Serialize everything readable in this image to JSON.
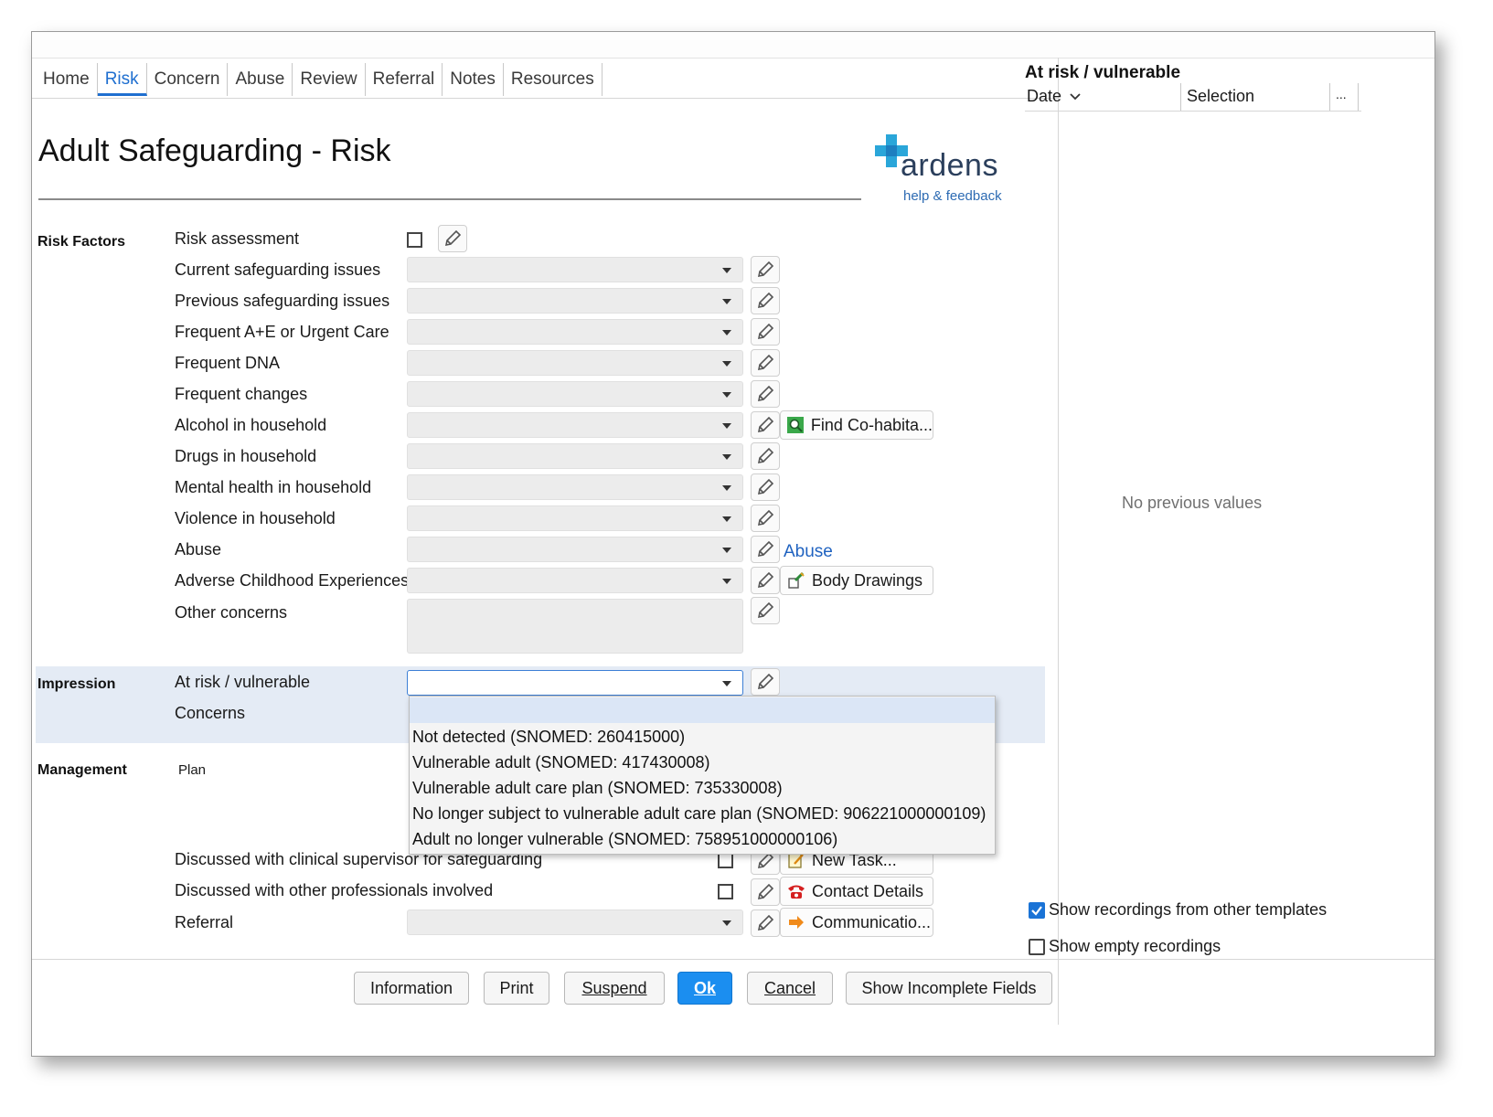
{
  "tabs": [
    "Home",
    "Risk",
    "Concern",
    "Abuse",
    "Review",
    "Referral",
    "Notes",
    "Resources"
  ],
  "active_tab": "Risk",
  "page_title": "Adult Safeguarding - Risk",
  "logo": {
    "name": "ardens",
    "link": "help & feedback"
  },
  "sections": {
    "risk_factors": "Risk Factors",
    "impression": "Impression",
    "management": "Management"
  },
  "risk": {
    "risk_assessment": "Risk assessment",
    "rows": [
      "Current safeguarding issues",
      "Previous safeguarding issues",
      "Frequent A+E or Urgent Care",
      "Frequent DNA",
      "Frequent changes",
      "Alcohol in household",
      "Drugs in household",
      "Mental health in household",
      "Violence in household",
      "Abuse",
      "Adverse Childhood Experiences"
    ],
    "other_concerns": "Other concerns",
    "find_cohabitants": "Find Co-habita...",
    "abuse_link": "Abuse",
    "body_drawings": "Body Drawings"
  },
  "impression": {
    "at_risk": "At risk / vulnerable",
    "concerns": "Concerns",
    "options": [
      "",
      "Not detected (SNOMED: 260415000)",
      "Vulnerable adult (SNOMED: 417430008)",
      "Vulnerable adult care plan (SNOMED: 735330008)",
      "No longer subject to vulnerable adult care plan (SNOMED: 906221000000109)",
      "Adult no longer vulnerable (SNOMED: 758951000000106)"
    ]
  },
  "management": {
    "plan": "Plan",
    "discussed_supervisor": "Discussed with clinical supervisor for safeguarding",
    "discussed_others": "Discussed with other professionals involved",
    "referral": "Referral",
    "new_task": "New Task...",
    "contact_details": "Contact Details",
    "communication": "Communicatio..."
  },
  "footer": {
    "information": "Information",
    "print": "Print",
    "suspend": "Suspend",
    "ok": "Ok",
    "cancel": "Cancel",
    "show_incomplete": "Show Incomplete Fields"
  },
  "side": {
    "title": "At risk / vulnerable",
    "col_date": "Date",
    "col_selection": "Selection",
    "col_more": "...",
    "empty": "No previous values",
    "show_other": "Show recordings from other templates",
    "show_other_checked": true,
    "show_empty": "Show empty recordings",
    "show_empty_checked": false
  },
  "colors": {
    "accent": "#1f6fd0",
    "ok_button": "#1b8ef0",
    "impression_band": "#e4ebf5"
  }
}
